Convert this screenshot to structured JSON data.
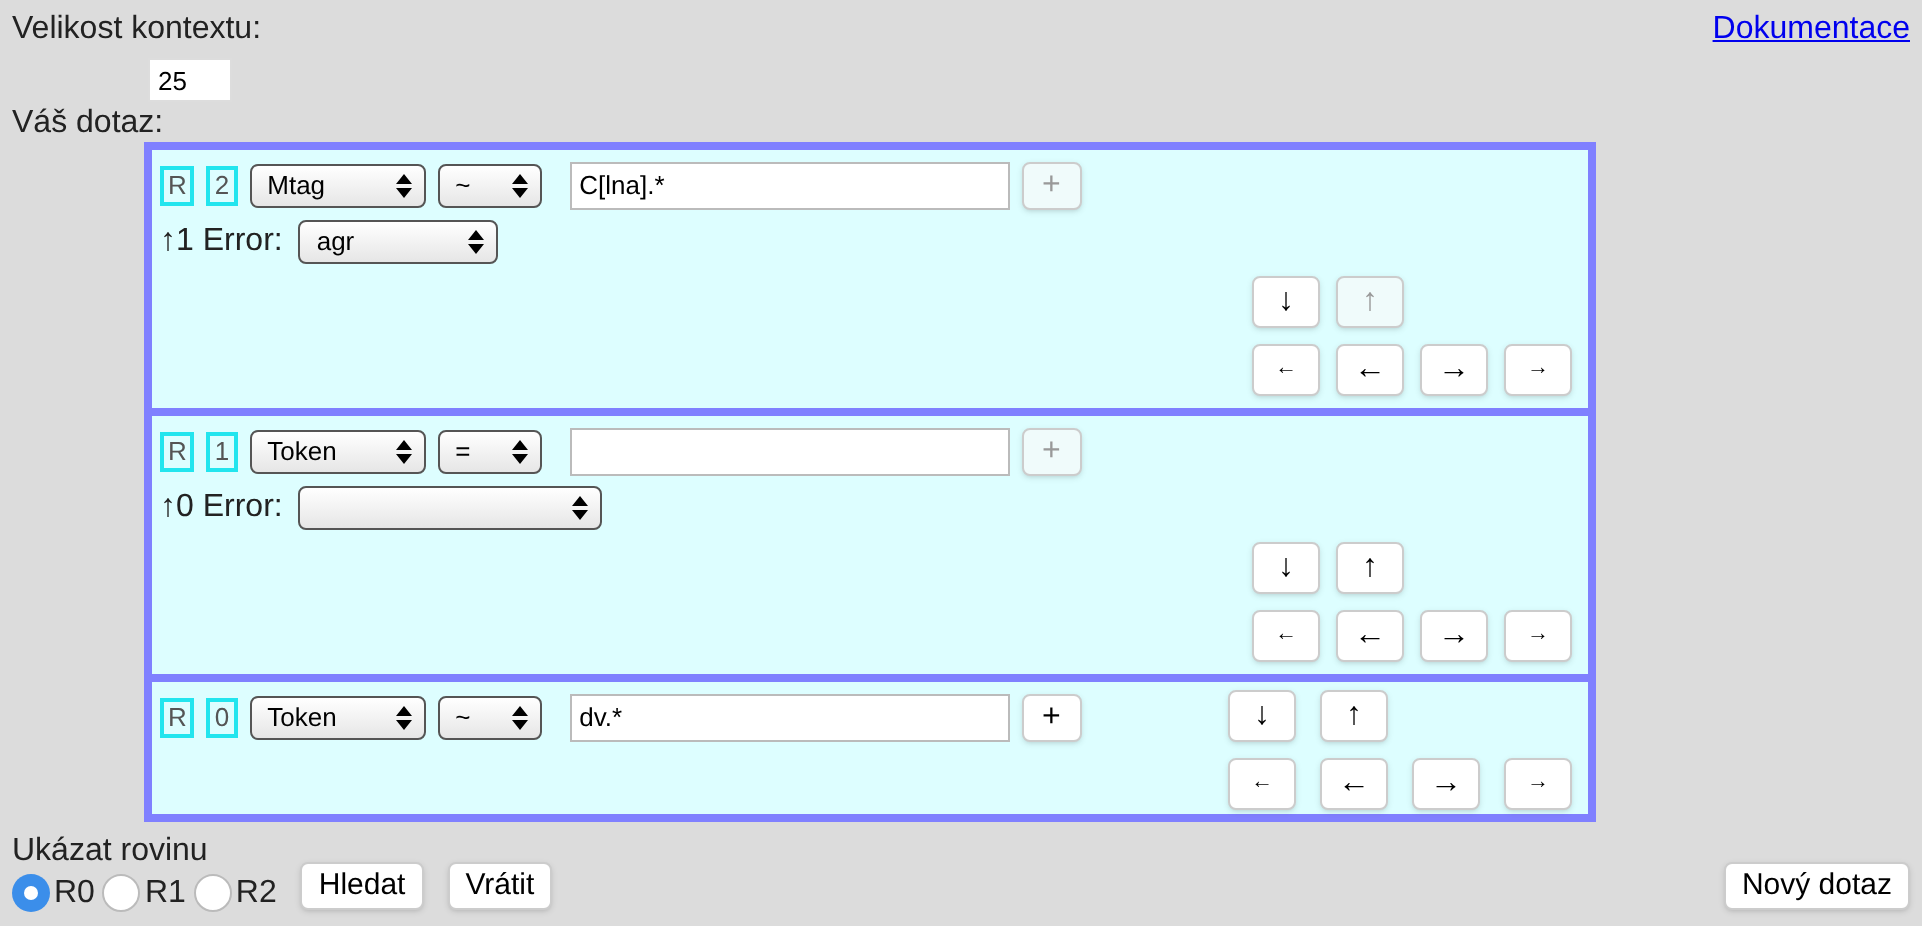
{
  "context": {
    "label": "Velikost kontextu:",
    "value": "25"
  },
  "doc_link": "Dokumentace",
  "query_label": "Váš dotaz:",
  "levels": [
    {
      "r": "R",
      "index": "2",
      "type": "Mtag",
      "op": "~",
      "value": "C[lna].*",
      "add": "+",
      "add_disabled": true,
      "error": {
        "label": "↑1 Error:",
        "value": "agr"
      },
      "nav": [
        {
          "label": "↓",
          "kind": "big",
          "disabled": false
        },
        {
          "label": "↑",
          "kind": "big",
          "disabled": true
        },
        {
          "label": "←",
          "kind": "small",
          "disabled": false
        },
        {
          "label": "←",
          "kind": "big",
          "disabled": false
        },
        {
          "label": "→",
          "kind": "big",
          "disabled": false
        },
        {
          "label": "→",
          "kind": "small",
          "disabled": false
        }
      ]
    },
    {
      "r": "R",
      "index": "1",
      "type": "Token",
      "op": "=",
      "add": "+",
      "add_disabled": true,
      "error": {
        "label": "↑0 Error:"
      },
      "nav": [
        {
          "label": "↓",
          "kind": "big",
          "disabled": false
        },
        {
          "label": "↑",
          "kind": "big",
          "disabled": false
        },
        {
          "label": "←",
          "kind": "small",
          "disabled": false
        },
        {
          "label": "←",
          "kind": "big",
          "disabled": false
        },
        {
          "label": "→",
          "kind": "big",
          "disabled": false
        },
        {
          "label": "→",
          "kind": "small",
          "disabled": false
        }
      ]
    },
    {
      "r": "R",
      "index": "0",
      "type": "Token",
      "op": "~",
      "value": "dv.*",
      "add": "+",
      "add_disabled": false,
      "nav": [
        {
          "label": "↓",
          "kind": "big",
          "disabled": false
        },
        {
          "label": "↑",
          "kind": "big",
          "disabled": false
        },
        {
          "label": "←",
          "kind": "small",
          "disabled": false
        },
        {
          "label": "←",
          "kind": "big",
          "disabled": false
        },
        {
          "label": "→",
          "kind": "big",
          "disabled": false
        },
        {
          "label": "→",
          "kind": "small",
          "disabled": false
        }
      ]
    }
  ],
  "show_level": {
    "label": "Ukázat rovinu",
    "options": [
      {
        "label": "R0",
        "selected": true
      },
      {
        "label": "R1",
        "selected": false
      },
      {
        "label": "R2",
        "selected": false
      }
    ]
  },
  "buttons": [
    "Hledat",
    "Vrátit"
  ],
  "new_query": "Nový dotaz"
}
